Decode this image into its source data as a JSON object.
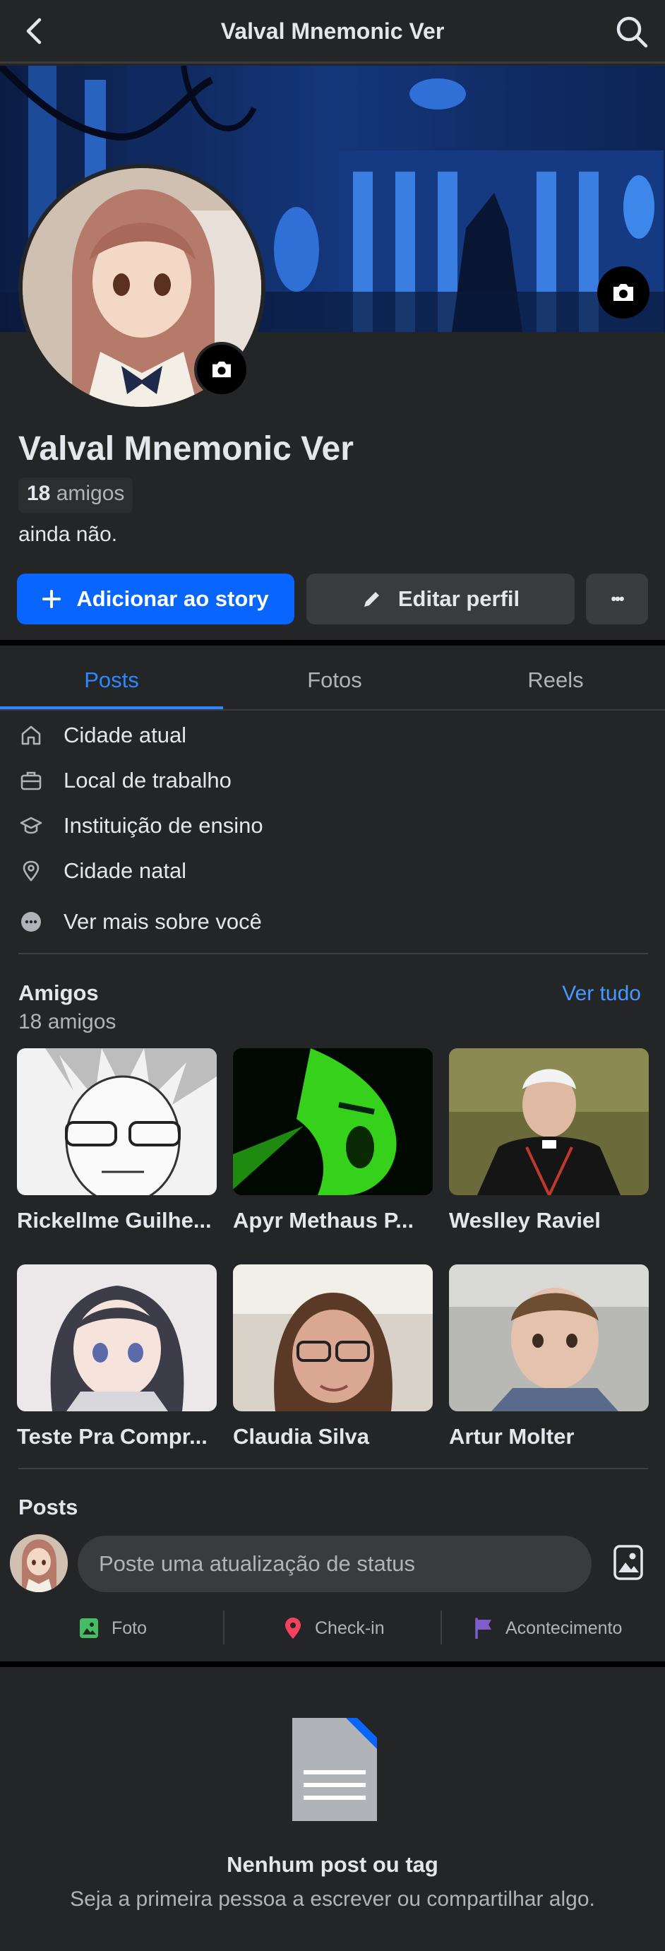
{
  "header": {
    "title": "Valval Mnemonic Ver"
  },
  "profile": {
    "name": "Valval Mnemonic Ver",
    "friends_number": "18",
    "friends_word": "amigos",
    "bio": "ainda não."
  },
  "buttons": {
    "add_story": "Adicionar ao story",
    "edit_profile": "Editar perfil",
    "more": "•••"
  },
  "tabs": [
    {
      "label": "Posts",
      "active": true
    },
    {
      "label": "Fotos",
      "active": false
    },
    {
      "label": "Reels",
      "active": false
    }
  ],
  "details": [
    {
      "icon": "home-icon",
      "label": "Cidade atual"
    },
    {
      "icon": "briefcase-icon",
      "label": "Local de trabalho"
    },
    {
      "icon": "graduation-cap-icon",
      "label": "Instituição de ensino"
    },
    {
      "icon": "location-pin-icon",
      "label": "Cidade natal"
    },
    {
      "icon": "more-dots-icon",
      "label": "Ver mais sobre você"
    }
  ],
  "friends_section": {
    "title": "Amigos",
    "subtitle": "18 amigos",
    "see_all": "Ver tudo",
    "friends": [
      {
        "name": "Rickellme Guilhe..."
      },
      {
        "name": "Apyr Methaus P..."
      },
      {
        "name": "Weslley Raviel"
      },
      {
        "name": "Teste Pra Compr..."
      },
      {
        "name": "Claudia Silva"
      },
      {
        "name": "Artur Molter"
      }
    ]
  },
  "posts_section": {
    "title": "Posts",
    "composer_placeholder": "Poste uma atualização de status",
    "actions": [
      {
        "label": "Foto",
        "icon": "photo-icon",
        "color": "#45bd62"
      },
      {
        "label": "Check-in",
        "icon": "location-pin-icon",
        "color": "#f3425f"
      },
      {
        "label": "Acontecimento",
        "icon": "flag-icon",
        "color": "#7f5ecb"
      }
    ]
  },
  "empty_state": {
    "title": "Nenhum post ou tag",
    "subtitle": "Seja a primeira pessoa a escrever ou compartilhar algo."
  },
  "colors": {
    "background": "#242526",
    "accent": "#0866ff",
    "link": "#2d88ff",
    "secondary_button": "#3a3b3c"
  }
}
